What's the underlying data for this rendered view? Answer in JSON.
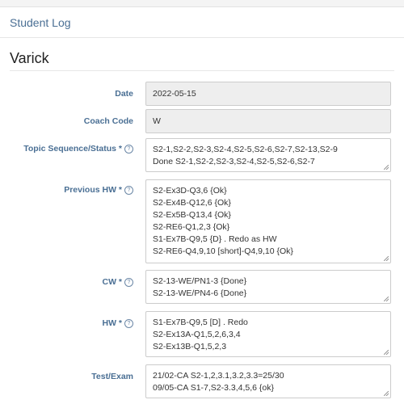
{
  "header": {
    "title": "Student Log"
  },
  "student": {
    "name": "Varick"
  },
  "form": {
    "date": {
      "label": "Date",
      "value": "2022-05-15"
    },
    "coach_code": {
      "label": "Coach Code",
      "value": "W"
    },
    "topic_sequence": {
      "label": "Topic Sequence/Status *",
      "lines": [
        "S2-1,S2-2,S2-3,S2-4,S2-5,S2-6,S2-7,S2-13,S2-9",
        "Done S2-1,S2-2,S2-3,S2-4,S2-5,S2-6,S2-7"
      ]
    },
    "previous_hw": {
      "label": "Previous HW *",
      "lines": [
        "S2-Ex3D-Q3,6 {Ok}",
        "S2-Ex4B-Q12,6 {Ok}",
        "S2-Ex5B-Q13,4 {Ok}",
        "S2-RE6-Q1,2,3 {Ok}",
        "S1-Ex7B-Q9,5 {D} . Redo as HW",
        "S2-RE6-Q4,9,10 [short]-Q4,9,10 {Ok}"
      ]
    },
    "cw": {
      "label": "CW *",
      "lines": [
        "S2-13-WE/PN1-3 {Done}",
        "S2-13-WE/PN4-6 {Done}"
      ]
    },
    "hw": {
      "label": "HW *",
      "lines": [
        "S1-Ex7B-Q9,5 [D] . Redo",
        "S2-Ex13A-Q1,5,2,6,3,4",
        "S2-Ex13B-Q1,5,2,3"
      ]
    },
    "test_exam": {
      "label": "Test/Exam",
      "lines": [
        "21/02-CA S2-1,2,3.1,3.2,3.3=25/30",
        "09/05-CA S1-7,S2-3.3,4,5,6 {ok}"
      ]
    }
  },
  "icons": {
    "help": "question-circle-icon",
    "resize": "resize-grip-icon"
  },
  "colors": {
    "label": "#4a6f94",
    "header": "#4a6f94",
    "disabled_bg": "#eeeeee"
  }
}
